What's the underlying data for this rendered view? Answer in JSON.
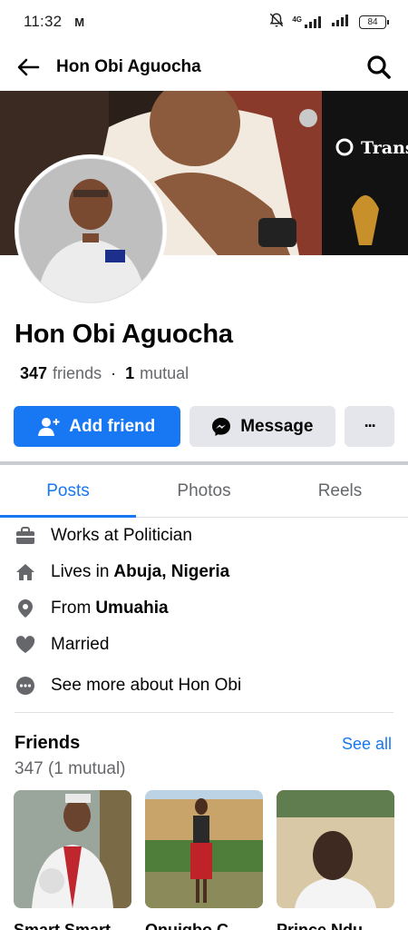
{
  "status_bar": {
    "time": "11:32",
    "carrier_icon": "M",
    "network": "4G",
    "battery": "84"
  },
  "header": {
    "title": "Hon Obi Aguocha",
    "back_icon": "arrow-left-icon",
    "search_icon": "search-icon"
  },
  "cover": {
    "caption": "Trans"
  },
  "profile": {
    "name": "Hon Obi Aguocha",
    "friends_count": "347",
    "friends_label": "friends",
    "separator": "·",
    "mutual_count": "1",
    "mutual_label": "mutual"
  },
  "actions": {
    "add_friend": "Add friend",
    "message": "Message",
    "more": "···"
  },
  "tabs": [
    {
      "label": "Posts",
      "active": true
    },
    {
      "label": "Photos",
      "active": false
    },
    {
      "label": "Reels",
      "active": false
    }
  ],
  "about": [
    {
      "icon": "briefcase-icon",
      "text": "Works at Politician",
      "bold": ""
    },
    {
      "icon": "home-icon",
      "text": "Lives in",
      "bold": "Abuja, Nigeria"
    },
    {
      "icon": "location-pin-icon",
      "text": "From",
      "bold": "Umuahia"
    },
    {
      "icon": "heart-icon",
      "text": "Married",
      "bold": ""
    },
    {
      "icon": "more-dots-icon",
      "text": "See more about Hon Obi",
      "bold": ""
    }
  ],
  "friends": {
    "title": "Friends",
    "see_all": "See all",
    "count_text": "347 (1 mutual)",
    "cards": [
      {
        "name": "Smart Smart"
      },
      {
        "name": "Onuigbo C"
      },
      {
        "name": "Prince Ndu"
      }
    ]
  },
  "colors": {
    "accent": "#1877f2",
    "secondary_button": "#e4e6eb",
    "muted_text": "#65676b"
  }
}
